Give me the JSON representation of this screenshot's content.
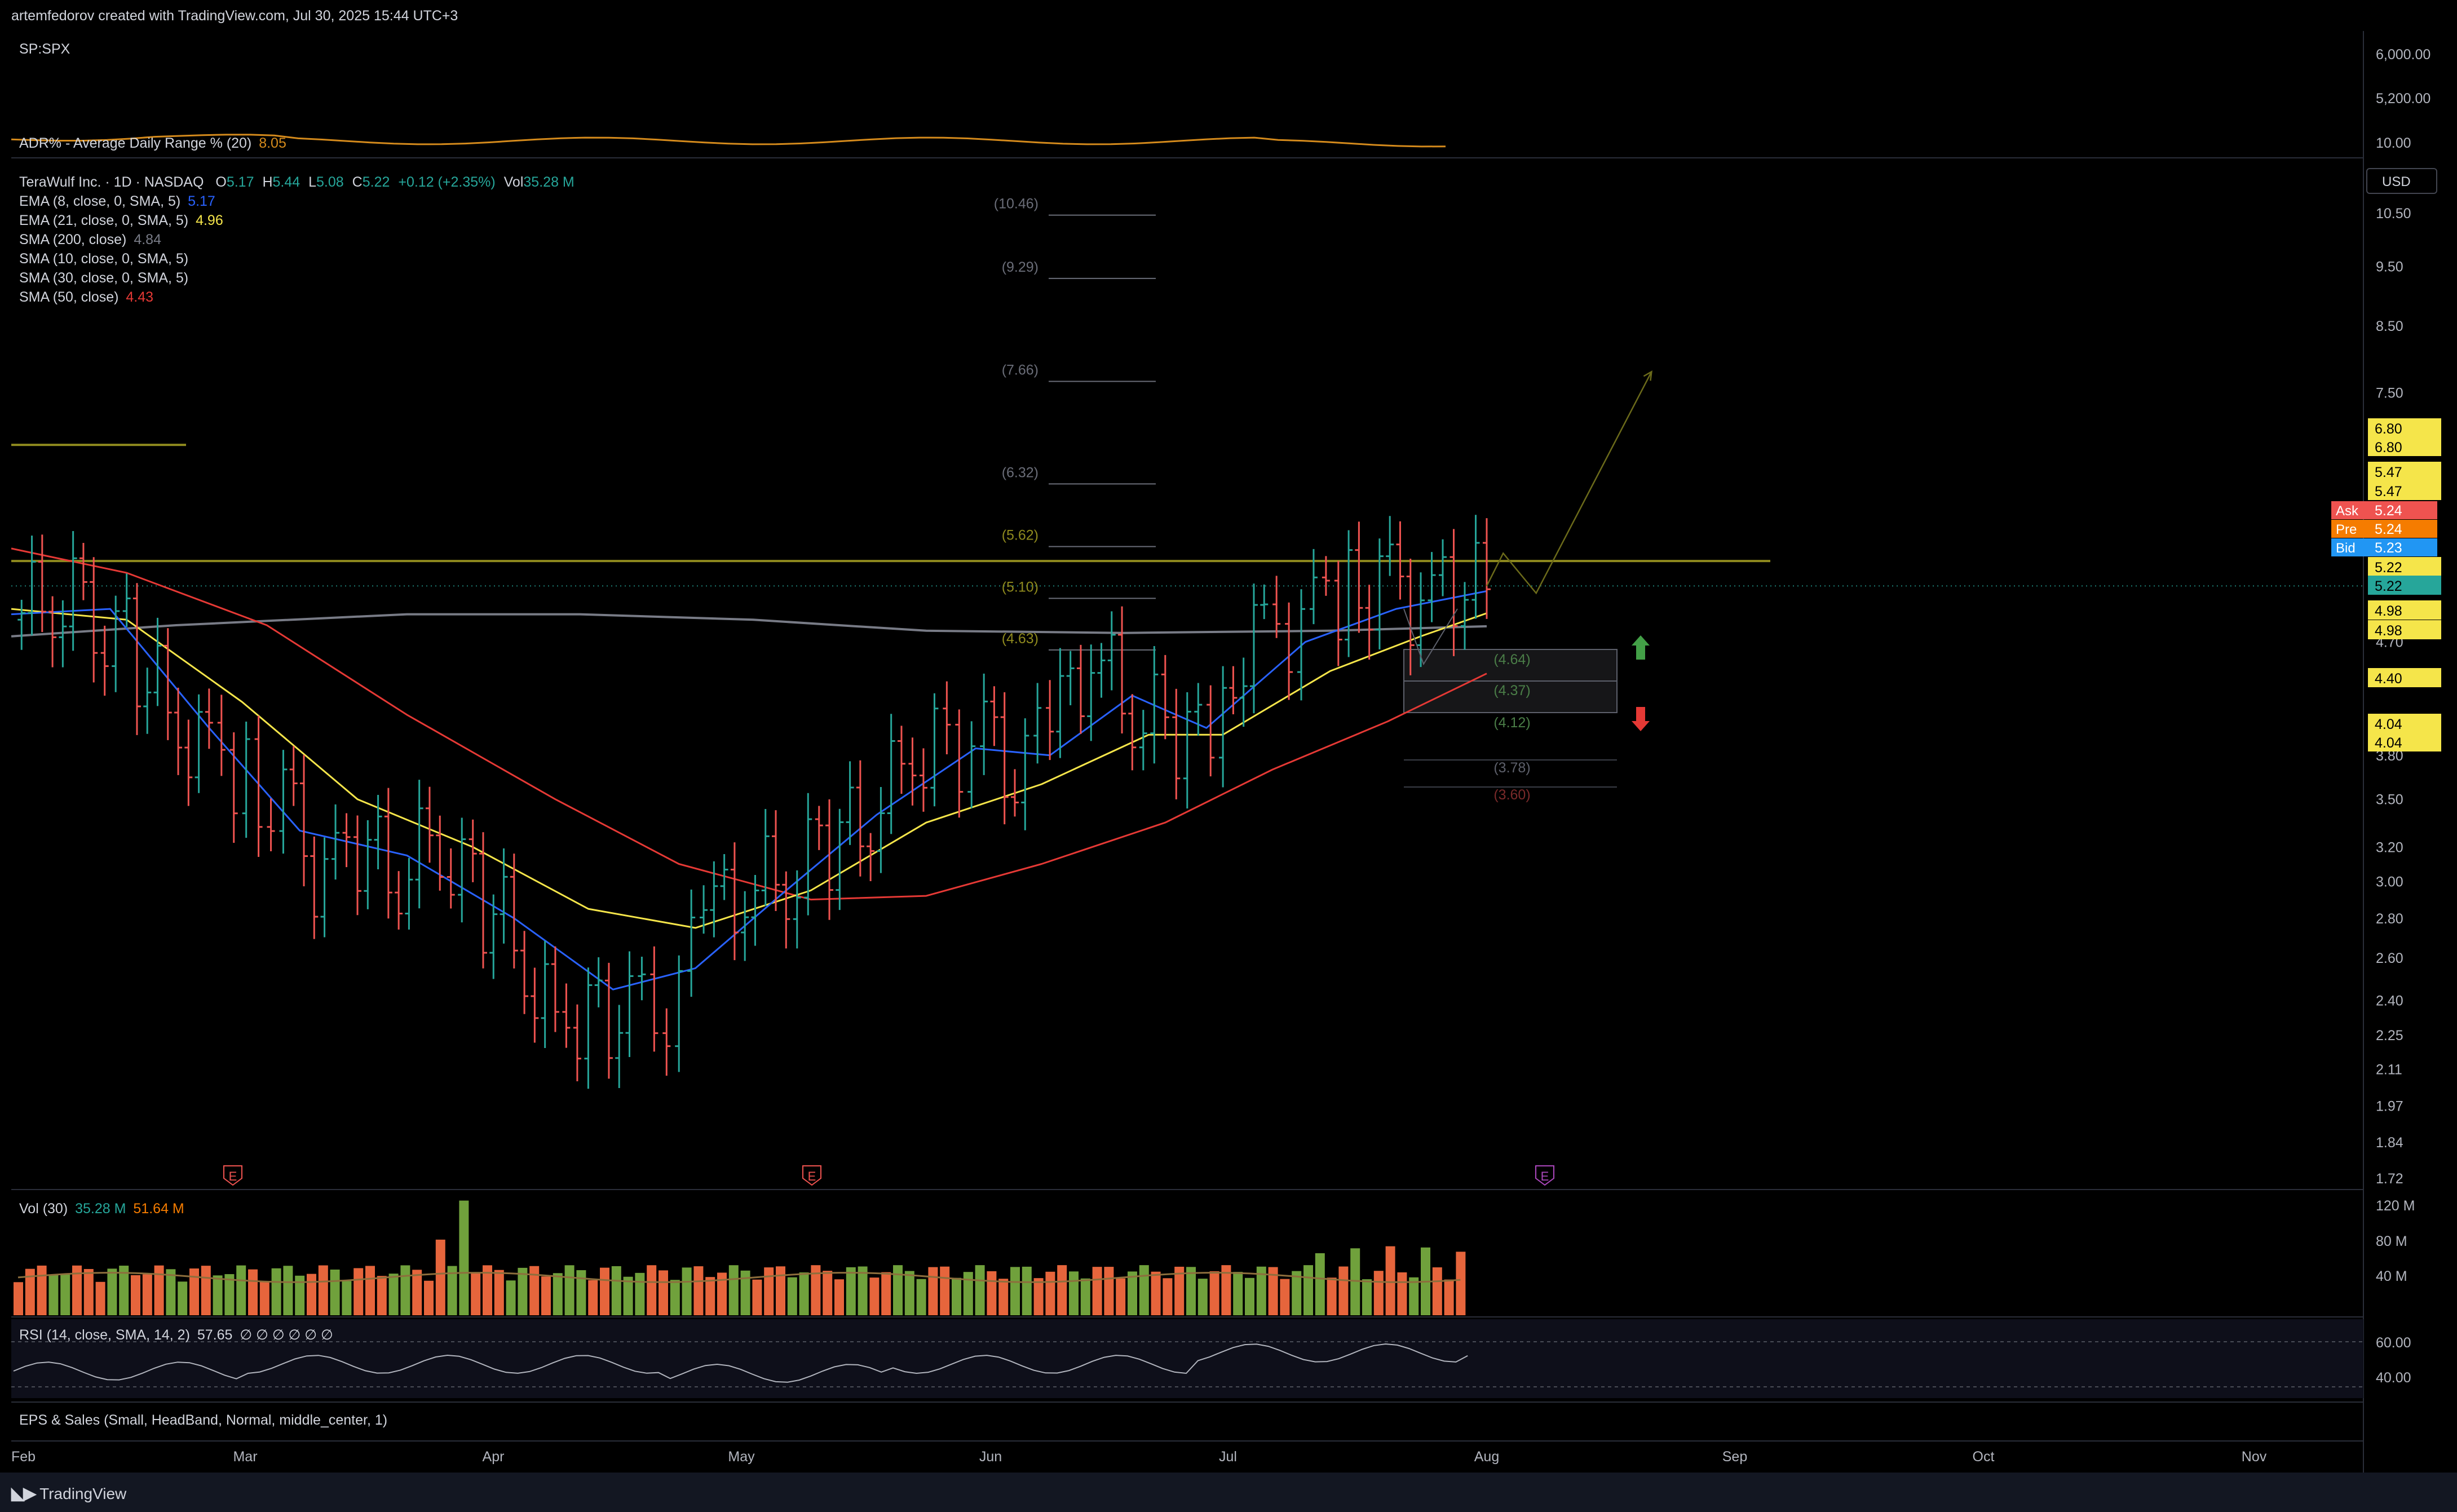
{
  "header": {
    "attribution": "artemfedorov created with TradingView.com, Jul 30, 2025 15:44 UTC+3"
  },
  "footer": {
    "logo": "TradingView"
  },
  "colors": {
    "up": "#26a69a",
    "down": "#ef5350",
    "ema8": "#2962ff",
    "ema21": "#f5e54a",
    "sma200": "#787b86",
    "sma50": "#e53935",
    "level": "#8f8a1e",
    "adr": "#d48a1c"
  },
  "top_pane": {
    "symbol": "SP:SPX",
    "adr_label": "ADR% - Average Daily Range % (20)",
    "adr_value": "8.05",
    "axis_labels": [
      "6,000.00",
      "5,200.00",
      "10.00"
    ]
  },
  "main_legend": {
    "title": "TeraWulf Inc. · 1D · NASDAQ",
    "o_label": "O",
    "o_value": "5.17",
    "h_label": "H",
    "h_value": "5.44",
    "l_label": "L",
    "l_value": "5.08",
    "c_label": "C",
    "c_value": "5.22",
    "change": "+0.12 (+2.35%)",
    "vol_label": "Vol",
    "vol_value": "35.28 M",
    "indicators": [
      {
        "label": "EMA (8, close, 0, SMA, 5)",
        "value": "5.17",
        "color": "#2962ff"
      },
      {
        "label": "EMA (21, close, 0, SMA, 5)",
        "value": "4.96",
        "color": "#f5e54a"
      },
      {
        "label": "SMA (200, close)",
        "value": "4.84",
        "color": "#787b86"
      },
      {
        "label": "SMA (10, close, 0, SMA, 5)",
        "value": "",
        "color": "#787b86"
      },
      {
        "label": "SMA (30, close, 0, SMA, 5)",
        "value": "",
        "color": "#787b86"
      },
      {
        "label": "SMA (50, close)",
        "value": "4.43",
        "color": "#e53935"
      }
    ]
  },
  "currency": "USD",
  "price_axis": {
    "ticks": [
      "10.50",
      "9.50",
      "8.50",
      "7.50",
      "4.70",
      "3.80",
      "3.50",
      "3.20",
      "3.00",
      "2.80",
      "2.60",
      "2.40",
      "2.25",
      "2.11",
      "1.97",
      "1.84",
      "1.72"
    ],
    "badges": [
      {
        "text": "6.80",
        "color": "#f5e54a"
      },
      {
        "text": "6.80",
        "color": "#f5e54a"
      },
      {
        "text": "5.47",
        "color": "#f5e54a"
      },
      {
        "text": "5.47",
        "color": "#f5e54a"
      },
      {
        "text": "5.22",
        "color": "#f5e54a"
      },
      {
        "text": "5.22",
        "color": "#26a69a"
      },
      {
        "text": "4.98",
        "color": "#f5e54a"
      },
      {
        "text": "4.98",
        "color": "#f5e54a"
      },
      {
        "text": "4.40",
        "color": "#f5e54a"
      },
      {
        "text": "4.04",
        "color": "#f5e54a"
      },
      {
        "text": "4.04",
        "color": "#f5e54a"
      }
    ],
    "quotes": [
      {
        "label": "Ask",
        "value": "5.24",
        "color": "#ef5350"
      },
      {
        "label": "Pre",
        "value": "5.24",
        "color": "#f57c00"
      },
      {
        "label": "Bid",
        "value": "5.23",
        "color": "#2196f3"
      }
    ]
  },
  "levels": {
    "fib_labels": [
      "(10.46)",
      "(9.29)",
      "(7.66)",
      "(6.32)",
      "(5.62)",
      "(5.10)",
      "(4.63)"
    ],
    "zone_labels": [
      "(4.64)",
      "(4.37)",
      "(4.12)",
      "(3.78)",
      "(3.60)"
    ]
  },
  "earnings_marker": "E",
  "volume_pane": {
    "label": "Vol (30)",
    "value1": "35.28 M",
    "value2": "51.64 M",
    "axis_labels": [
      "120 M",
      "80 M",
      "40 M"
    ]
  },
  "rsi_pane": {
    "label": "RSI (14, close, SMA, 14, 2)",
    "value": "57.65",
    "nulls": "∅ ∅ ∅ ∅ ∅ ∅",
    "axis_labels": [
      "60.00",
      "40.00"
    ]
  },
  "eps_pane": {
    "label": "EPS & Sales (Small, HeadBand, Normal, middle_center, 1)"
  },
  "time_axis": {
    "labels": [
      "Feb",
      "Mar",
      "Apr",
      "May",
      "Jun",
      "Jul",
      "Aug",
      "Sep",
      "Oct",
      "Nov"
    ]
  },
  "chart_data": {
    "type": "candlestick",
    "symbol": "TeraWulf Inc. · 1D · NASDAQ",
    "last_close": 5.22,
    "log_scale": true,
    "y_range": [
      1.72,
      10.5
    ],
    "months": [
      "Feb",
      "Mar",
      "Apr",
      "May",
      "Jun",
      "Jul",
      "Aug",
      "Sep",
      "Oct",
      "Nov"
    ],
    "close_path": [
      {
        "date": "2025-01-31",
        "close": 4.9
      },
      {
        "date": "2025-02-05",
        "close": 5.15
      },
      {
        "date": "2025-02-10",
        "close": 5.05
      },
      {
        "date": "2025-02-14",
        "close": 4.7
      },
      {
        "date": "2025-02-19",
        "close": 4.1
      },
      {
        "date": "2025-02-24",
        "close": 3.8
      },
      {
        "date": "2025-02-27",
        "close": 3.75
      },
      {
        "date": "2025-03-05",
        "close": 3.4
      },
      {
        "date": "2025-03-10",
        "close": 3.0
      },
      {
        "date": "2025-03-14",
        "close": 3.2
      },
      {
        "date": "2025-03-19",
        "close": 3.05
      },
      {
        "date": "2025-03-24",
        "close": 3.3
      },
      {
        "date": "2025-03-28",
        "close": 2.95
      },
      {
        "date": "2025-04-02",
        "close": 2.7
      },
      {
        "date": "2025-04-07",
        "close": 2.25
      },
      {
        "date": "2025-04-11",
        "close": 2.4
      },
      {
        "date": "2025-04-16",
        "close": 2.3
      },
      {
        "date": "2025-04-22",
        "close": 2.4
      },
      {
        "date": "2025-04-25",
        "close": 2.8
      },
      {
        "date": "2025-04-30",
        "close": 2.95
      },
      {
        "date": "2025-05-05",
        "close": 3.05
      },
      {
        "date": "2025-05-09",
        "close": 3.2
      },
      {
        "date": "2025-05-14",
        "close": 3.35
      },
      {
        "date": "2025-05-19",
        "close": 3.7
      },
      {
        "date": "2025-05-23",
        "close": 3.95
      },
      {
        "date": "2025-05-29",
        "close": 3.85
      },
      {
        "date": "2025-06-03",
        "close": 3.65
      },
      {
        "date": "2025-06-06",
        "close": 4.0
      },
      {
        "date": "2025-06-11",
        "close": 4.55
      },
      {
        "date": "2025-06-16",
        "close": 4.2
      },
      {
        "date": "2025-06-20",
        "close": 4.0
      },
      {
        "date": "2025-06-24",
        "close": 3.9
      },
      {
        "date": "2025-06-27",
        "close": 4.35
      },
      {
        "date": "2025-07-02",
        "close": 4.85
      },
      {
        "date": "2025-07-08",
        "close": 4.9
      },
      {
        "date": "2025-07-11",
        "close": 5.1
      },
      {
        "date": "2025-07-16",
        "close": 5.25
      },
      {
        "date": "2025-07-21",
        "close": 5.1
      },
      {
        "date": "2025-07-25",
        "close": 5.15
      },
      {
        "date": "2025-07-29",
        "close": 5.22
      }
    ],
    "ema8": [
      {
        "date": "2025-01-31",
        "v": 4.95
      },
      {
        "date": "2025-02-12",
        "v": 5.0
      },
      {
        "date": "2025-02-24",
        "v": 4.0
      },
      {
        "date": "2025-03-07",
        "v": 3.3
      },
      {
        "date": "2025-03-20",
        "v": 3.15
      },
      {
        "date": "2025-04-02",
        "v": 2.8
      },
      {
        "date": "2025-04-14",
        "v": 2.45
      },
      {
        "date": "2025-04-24",
        "v": 2.55
      },
      {
        "date": "2025-05-05",
        "v": 2.95
      },
      {
        "date": "2025-05-16",
        "v": 3.4
      },
      {
        "date": "2025-05-28",
        "v": 3.85
      },
      {
        "date": "2025-06-06",
        "v": 3.8
      },
      {
        "date": "2025-06-16",
        "v": 4.25
      },
      {
        "date": "2025-06-25",
        "v": 4.0
      },
      {
        "date": "2025-07-07",
        "v": 4.7
      },
      {
        "date": "2025-07-18",
        "v": 5.0
      },
      {
        "date": "2025-07-29",
        "v": 5.17
      }
    ],
    "ema21": [
      {
        "date": "2025-01-31",
        "v": 5.0
      },
      {
        "date": "2025-02-14",
        "v": 4.9
      },
      {
        "date": "2025-02-28",
        "v": 4.2
      },
      {
        "date": "2025-03-14",
        "v": 3.5
      },
      {
        "date": "2025-03-28",
        "v": 3.2
      },
      {
        "date": "2025-04-11",
        "v": 2.85
      },
      {
        "date": "2025-04-24",
        "v": 2.75
      },
      {
        "date": "2025-05-08",
        "v": 2.95
      },
      {
        "date": "2025-05-22",
        "v": 3.35
      },
      {
        "date": "2025-06-05",
        "v": 3.6
      },
      {
        "date": "2025-06-18",
        "v": 3.95
      },
      {
        "date": "2025-06-27",
        "v": 3.95
      },
      {
        "date": "2025-07-10",
        "v": 4.45
      },
      {
        "date": "2025-07-21",
        "v": 4.75
      },
      {
        "date": "2025-07-29",
        "v": 4.96
      }
    ],
    "sma200": [
      {
        "date": "2025-01-31",
        "v": 4.75
      },
      {
        "date": "2025-02-20",
        "v": 4.85
      },
      {
        "date": "2025-03-20",
        "v": 4.95
      },
      {
        "date": "2025-04-10",
        "v": 4.95
      },
      {
        "date": "2025-05-01",
        "v": 4.9
      },
      {
        "date": "2025-05-22",
        "v": 4.8
      },
      {
        "date": "2025-06-15",
        "v": 4.78
      },
      {
        "date": "2025-07-10",
        "v": 4.8
      },
      {
        "date": "2025-07-29",
        "v": 4.84
      }
    ],
    "sma50": [
      {
        "date": "2025-01-31",
        "v": 5.6
      },
      {
        "date": "2025-02-14",
        "v": 5.35
      },
      {
        "date": "2025-03-03",
        "v": 4.85
      },
      {
        "date": "2025-03-20",
        "v": 4.1
      },
      {
        "date": "2025-04-07",
        "v": 3.5
      },
      {
        "date": "2025-04-22",
        "v": 3.1
      },
      {
        "date": "2025-05-08",
        "v": 2.9
      },
      {
        "date": "2025-05-22",
        "v": 2.92
      },
      {
        "date": "2025-06-05",
        "v": 3.1
      },
      {
        "date": "2025-06-20",
        "v": 3.35
      },
      {
        "date": "2025-07-03",
        "v": 3.7
      },
      {
        "date": "2025-07-17",
        "v": 4.05
      },
      {
        "date": "2025-07-29",
        "v": 4.43
      }
    ],
    "horizontal_levels": [
      5.47,
      6.8
    ],
    "projection": [
      {
        "date": "2025-07-31",
        "v": 5.55
      },
      {
        "date": "2025-08-04",
        "v": 5.15
      },
      {
        "date": "2025-08-18",
        "v": 7.8
      }
    ],
    "volume_axis": [
      "120 M",
      "80 M",
      "40 M"
    ],
    "rsi_axis": [
      "60.00",
      "40.00"
    ],
    "rsi_last": 57.65
  }
}
